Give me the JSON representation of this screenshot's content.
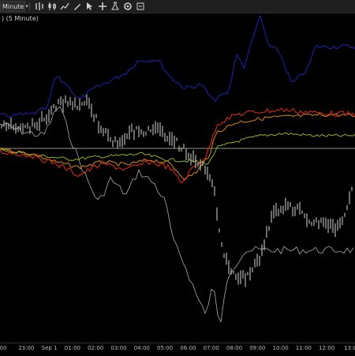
{
  "toolbar": {
    "interval": "Minute",
    "buttons": [
      {
        "name": "bar-style-icon",
        "glyph": "bars"
      },
      {
        "name": "candle-style-icon",
        "glyph": "candle"
      },
      {
        "name": "line-style-icon",
        "glyph": "line"
      },
      {
        "name": "pencil-draw-icon",
        "glyph": "pencil"
      },
      {
        "name": "cursor-pointer-icon",
        "glyph": "cursor"
      },
      {
        "name": "add-indicator-icon",
        "glyph": "plus"
      },
      {
        "name": "strategy-icon",
        "glyph": "flask"
      },
      {
        "name": "settings-icon",
        "glyph": "gear"
      },
      {
        "name": "more-icon",
        "glyph": "dots"
      }
    ]
  },
  "chart": {
    "title": ") (5 Minute)",
    "colors": {
      "price": "#d8d8d8",
      "blue": "#1a1f9a",
      "red": "#d42a12",
      "orange": "#d9891a",
      "green": "#8fb61c",
      "gray_line": "#9a9a9a",
      "hline": "#b7b7a0"
    },
    "time_labels": [
      "00",
      "23:00",
      "Sep 1",
      "01:00",
      "02:00",
      "03:00",
      "04:00",
      "05:00",
      "06:00",
      "07:00",
      "08:00",
      "09:00",
      "10:00",
      "11:00",
      "12:00",
      "13:0"
    ]
  }
}
